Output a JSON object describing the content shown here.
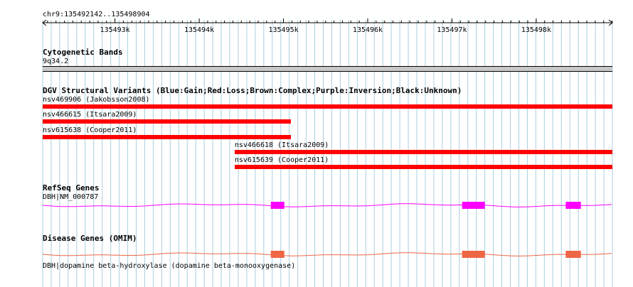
{
  "ruler": {
    "locus": "chr9:135492142..135498904",
    "start": 135492142,
    "end": 135498904,
    "ticks": [
      {
        "pos": 135493000,
        "label": "135493k"
      },
      {
        "pos": 135494000,
        "label": "135494k"
      },
      {
        "pos": 135495000,
        "label": "135495k"
      },
      {
        "pos": 135496000,
        "label": "135496k"
      },
      {
        "pos": 135497000,
        "label": "135497k"
      },
      {
        "pos": 135498000,
        "label": "135498k"
      }
    ]
  },
  "cytoband": {
    "title": "Cytogenetic Bands",
    "band": "9q34.2"
  },
  "dgv": {
    "title": "DGV Structural Variants (Blue:Gain;Red:Loss;Brown:Complex;Purple:Inversion;Black:Unknown)",
    "loss_color": "#ff0000",
    "variants": [
      {
        "label": "nsv469906 (Jakobsson2008)",
        "start": 135492142,
        "end": 135498904
      },
      {
        "label": "nsv466615 (Itsara2009)",
        "start": 135492142,
        "end": 135495090
      },
      {
        "label": "nsv615638 (Cooper2011)",
        "start": 135492142,
        "end": 135495090
      },
      {
        "label": "nsv466618 (Itsara2009)",
        "start": 135494420,
        "end": 135498904
      },
      {
        "label": "nsv615639 (Cooper2011)",
        "start": 135494420,
        "end": 135498904
      }
    ]
  },
  "refseq": {
    "title": "RefSeq Genes",
    "gene_label": "DBH|NM_000787",
    "color": "#ff00ff",
    "exons": [
      {
        "start": 135494850,
        "end": 135495010
      },
      {
        "start": 135497120,
        "end": 135497390
      },
      {
        "start": 135498350,
        "end": 135498530
      }
    ]
  },
  "omim": {
    "title": "Disease Genes (OMIM)",
    "gene_label": "DBH|dopamine beta-hydroxylase (dopamine beta-monooxygenase)",
    "color": "#ee6644",
    "exons": [
      {
        "start": 135494850,
        "end": 135495010
      },
      {
        "start": 135497120,
        "end": 135497390
      },
      {
        "start": 135498350,
        "end": 135498530
      }
    ]
  },
  "colors": {
    "grid_line": "#a8cfe0",
    "cytoband_fill": "#c8c8c8"
  }
}
